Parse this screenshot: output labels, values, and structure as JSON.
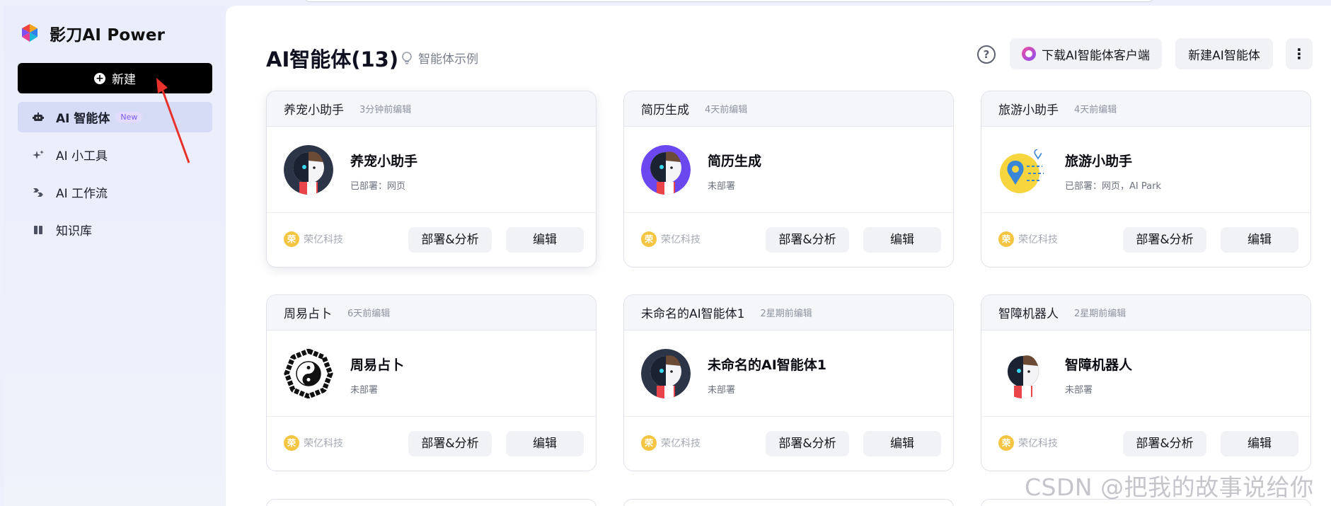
{
  "app": {
    "brand_name": "影刀AI Power"
  },
  "sidebar": {
    "new_label": "新建",
    "items": [
      {
        "label": "AI 智能体",
        "badge": "New",
        "icon": "robot-icon",
        "active": true
      },
      {
        "label": "AI 小工具",
        "icon": "sparkle-icon"
      },
      {
        "label": "AI 工作流",
        "icon": "workflow-icon"
      },
      {
        "label": "知识库",
        "icon": "book-icon"
      }
    ]
  },
  "header": {
    "title": "AI智能体(13)",
    "example_link": "智能体示例",
    "help_symbol": "?",
    "download_label": "下载AI智能体客户端",
    "new_agent_label": "新建AI智能体",
    "more_symbol": "⋮"
  },
  "cards": [
    {
      "name": "养宠小助手",
      "edited": "3分钟前编辑",
      "title": "养宠小助手",
      "status": "已部署：网页",
      "org": "荣亿科技",
      "org_mark": "荣",
      "deploy": "部署&分析",
      "edit": "编辑",
      "avatar": "robot-avatar-dark"
    },
    {
      "name": "简历生成",
      "edited": "4天前编辑",
      "title": "简历生成",
      "status": "未部署",
      "org": "荣亿科技",
      "org_mark": "荣",
      "deploy": "部署&分析",
      "edit": "编辑",
      "avatar": "robot-avatar-purple"
    },
    {
      "name": "旅游小助手",
      "edited": "4天前编辑",
      "title": "旅游小助手",
      "status": "已部署：网页，AI Park",
      "org": "荣亿科技",
      "org_mark": "荣",
      "deploy": "部署&分析",
      "edit": "编辑",
      "avatar": "travel-pin-avatar"
    },
    {
      "name": "周易占卜",
      "edited": "6天前编辑",
      "title": "周易占卜",
      "status": "未部署",
      "org": "荣亿科技",
      "org_mark": "荣",
      "deploy": "部署&分析",
      "edit": "编辑",
      "avatar": "bagua-avatar"
    },
    {
      "name": "未命名的AI智能体1",
      "edited": "2星期前编辑",
      "title": "未命名的AI智能体1",
      "status": "未部署",
      "org": "荣亿科技",
      "org_mark": "荣",
      "deploy": "部署&分析",
      "edit": "编辑",
      "avatar": "robot-avatar-dark"
    },
    {
      "name": "智障机器人",
      "edited": "2星期前编辑",
      "title": "智障机器人",
      "status": "未部署",
      "org": "荣亿科技",
      "org_mark": "荣",
      "deploy": "部署&分析",
      "edit": "编辑",
      "avatar": "robot-avatar-light"
    }
  ],
  "watermark": "CSDN @把我的故事说给你",
  "colors": {
    "accent_black": "#000000",
    "sidebar_bg": "#eaedfb",
    "active_item": "#d6dcf6",
    "badge": "#7b5cf0",
    "annotation_arrow": "#e8322b"
  }
}
